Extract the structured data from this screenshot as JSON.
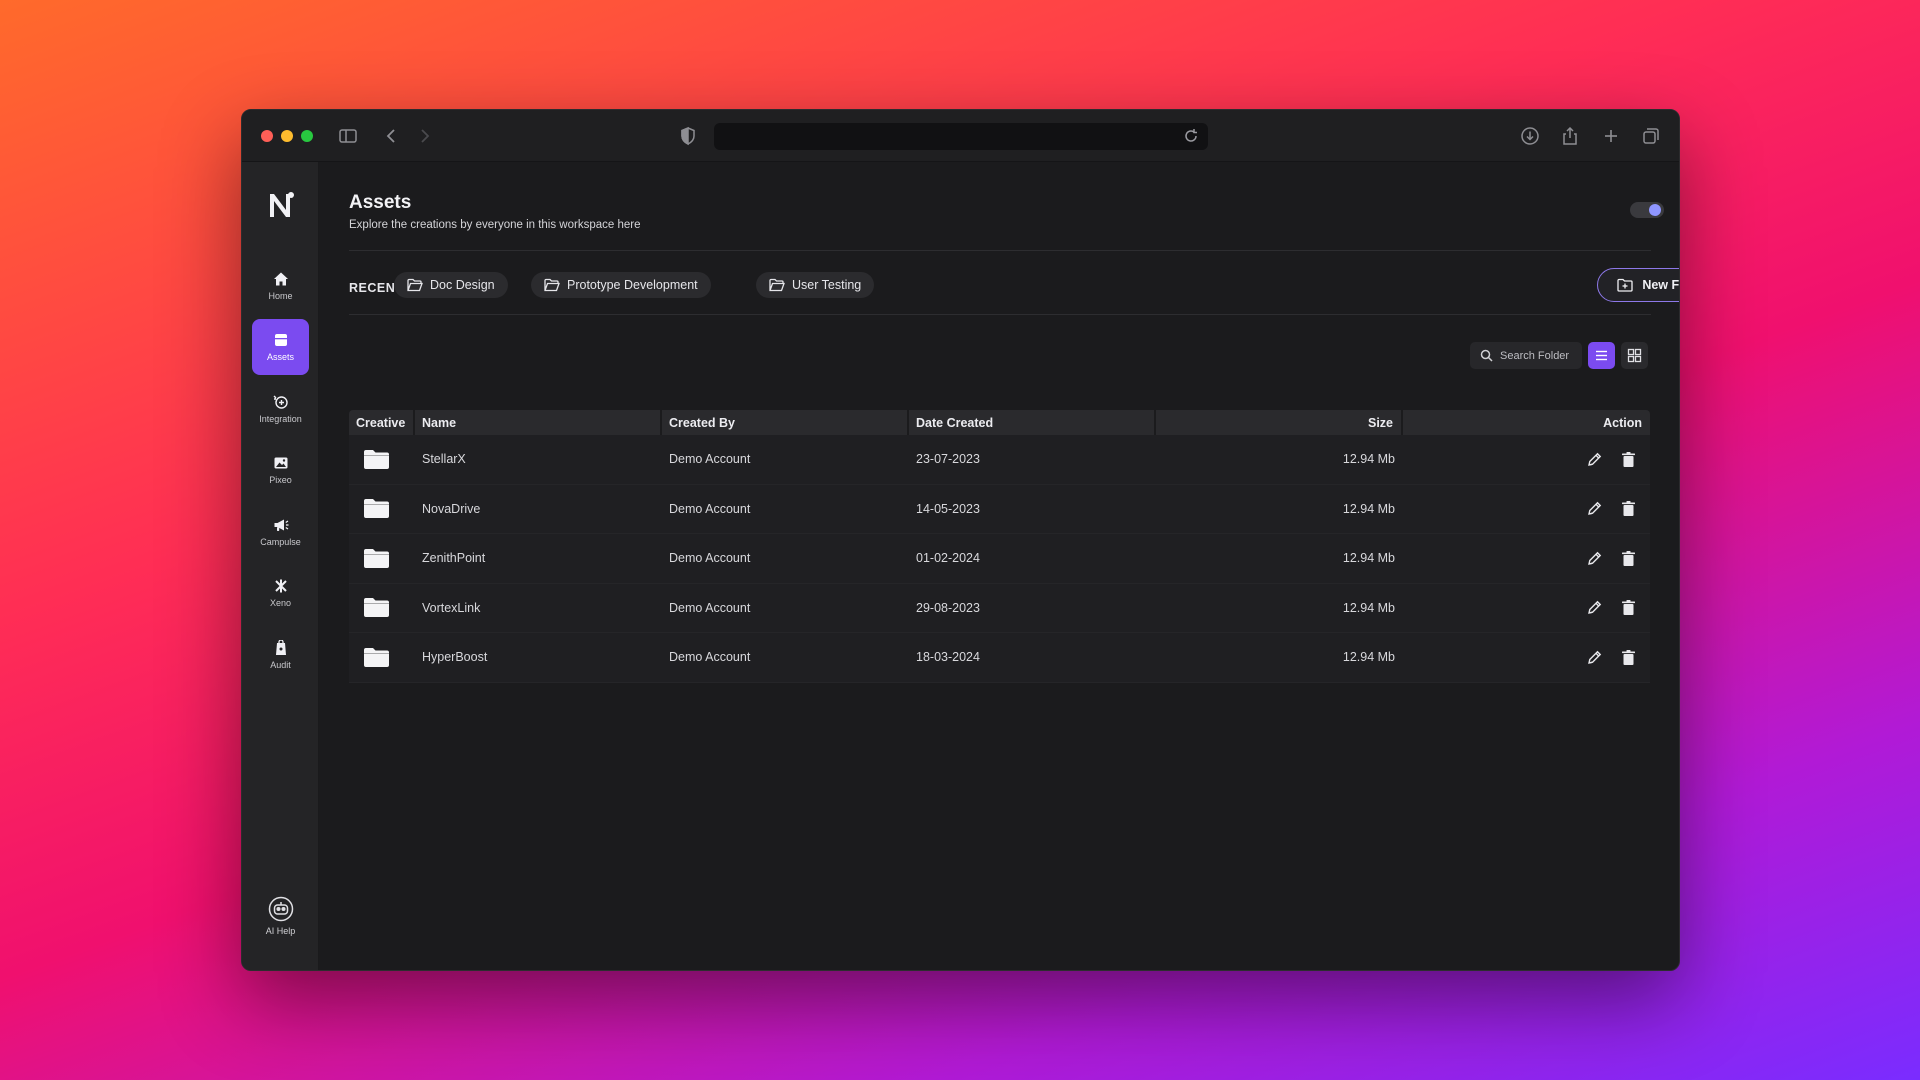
{
  "page": {
    "title": "Assets",
    "subtitle": "Explore the creations by everyone in this workspace here"
  },
  "sidebar": {
    "items": [
      {
        "label": "Home",
        "icon": "home-icon",
        "active": false
      },
      {
        "label": "Assets",
        "icon": "assets-icon",
        "active": true
      },
      {
        "label": "Integration",
        "icon": "integration-icon",
        "active": false
      },
      {
        "label": "Pixeo",
        "icon": "image-icon",
        "active": false
      },
      {
        "label": "Campulse",
        "icon": "megaphone-icon",
        "active": false
      },
      {
        "label": "Xeno",
        "icon": "xeno-icon",
        "active": false
      },
      {
        "label": "Audit",
        "icon": "audit-icon",
        "active": false
      }
    ],
    "ai_help": "AI Help"
  },
  "recent": {
    "label": "RECENT",
    "chips": [
      "Doc Design",
      "Prototype Development",
      "User Testing"
    ]
  },
  "toolbar": {
    "new_folder": "New Folder",
    "search_placeholder": "Search Folder",
    "view_mode": "list"
  },
  "table": {
    "headers": [
      "Creative",
      "Name",
      "Created By",
      "Date Created",
      "Size",
      "Action"
    ],
    "rows": [
      {
        "name": "StellarX",
        "created_by": "Demo Account",
        "date": "23-07-2023",
        "size": "12.94 Mb"
      },
      {
        "name": "NovaDrive",
        "created_by": "Demo Account",
        "date": "14-05-2023",
        "size": "12.94 Mb"
      },
      {
        "name": "ZenithPoint",
        "created_by": "Demo Account",
        "date": "01-02-2024",
        "size": "12.94 Mb"
      },
      {
        "name": "VortexLink",
        "created_by": "Demo Account",
        "date": "29-08-2023",
        "size": "12.94 Mb"
      },
      {
        "name": "HyperBoost",
        "created_by": "Demo Account",
        "date": "18-03-2024",
        "size": "12.94 Mb"
      }
    ]
  },
  "colors": {
    "accent": "#7b4bf0",
    "window_bg": "#1b1b1d",
    "sidebar_bg": "#242426"
  }
}
